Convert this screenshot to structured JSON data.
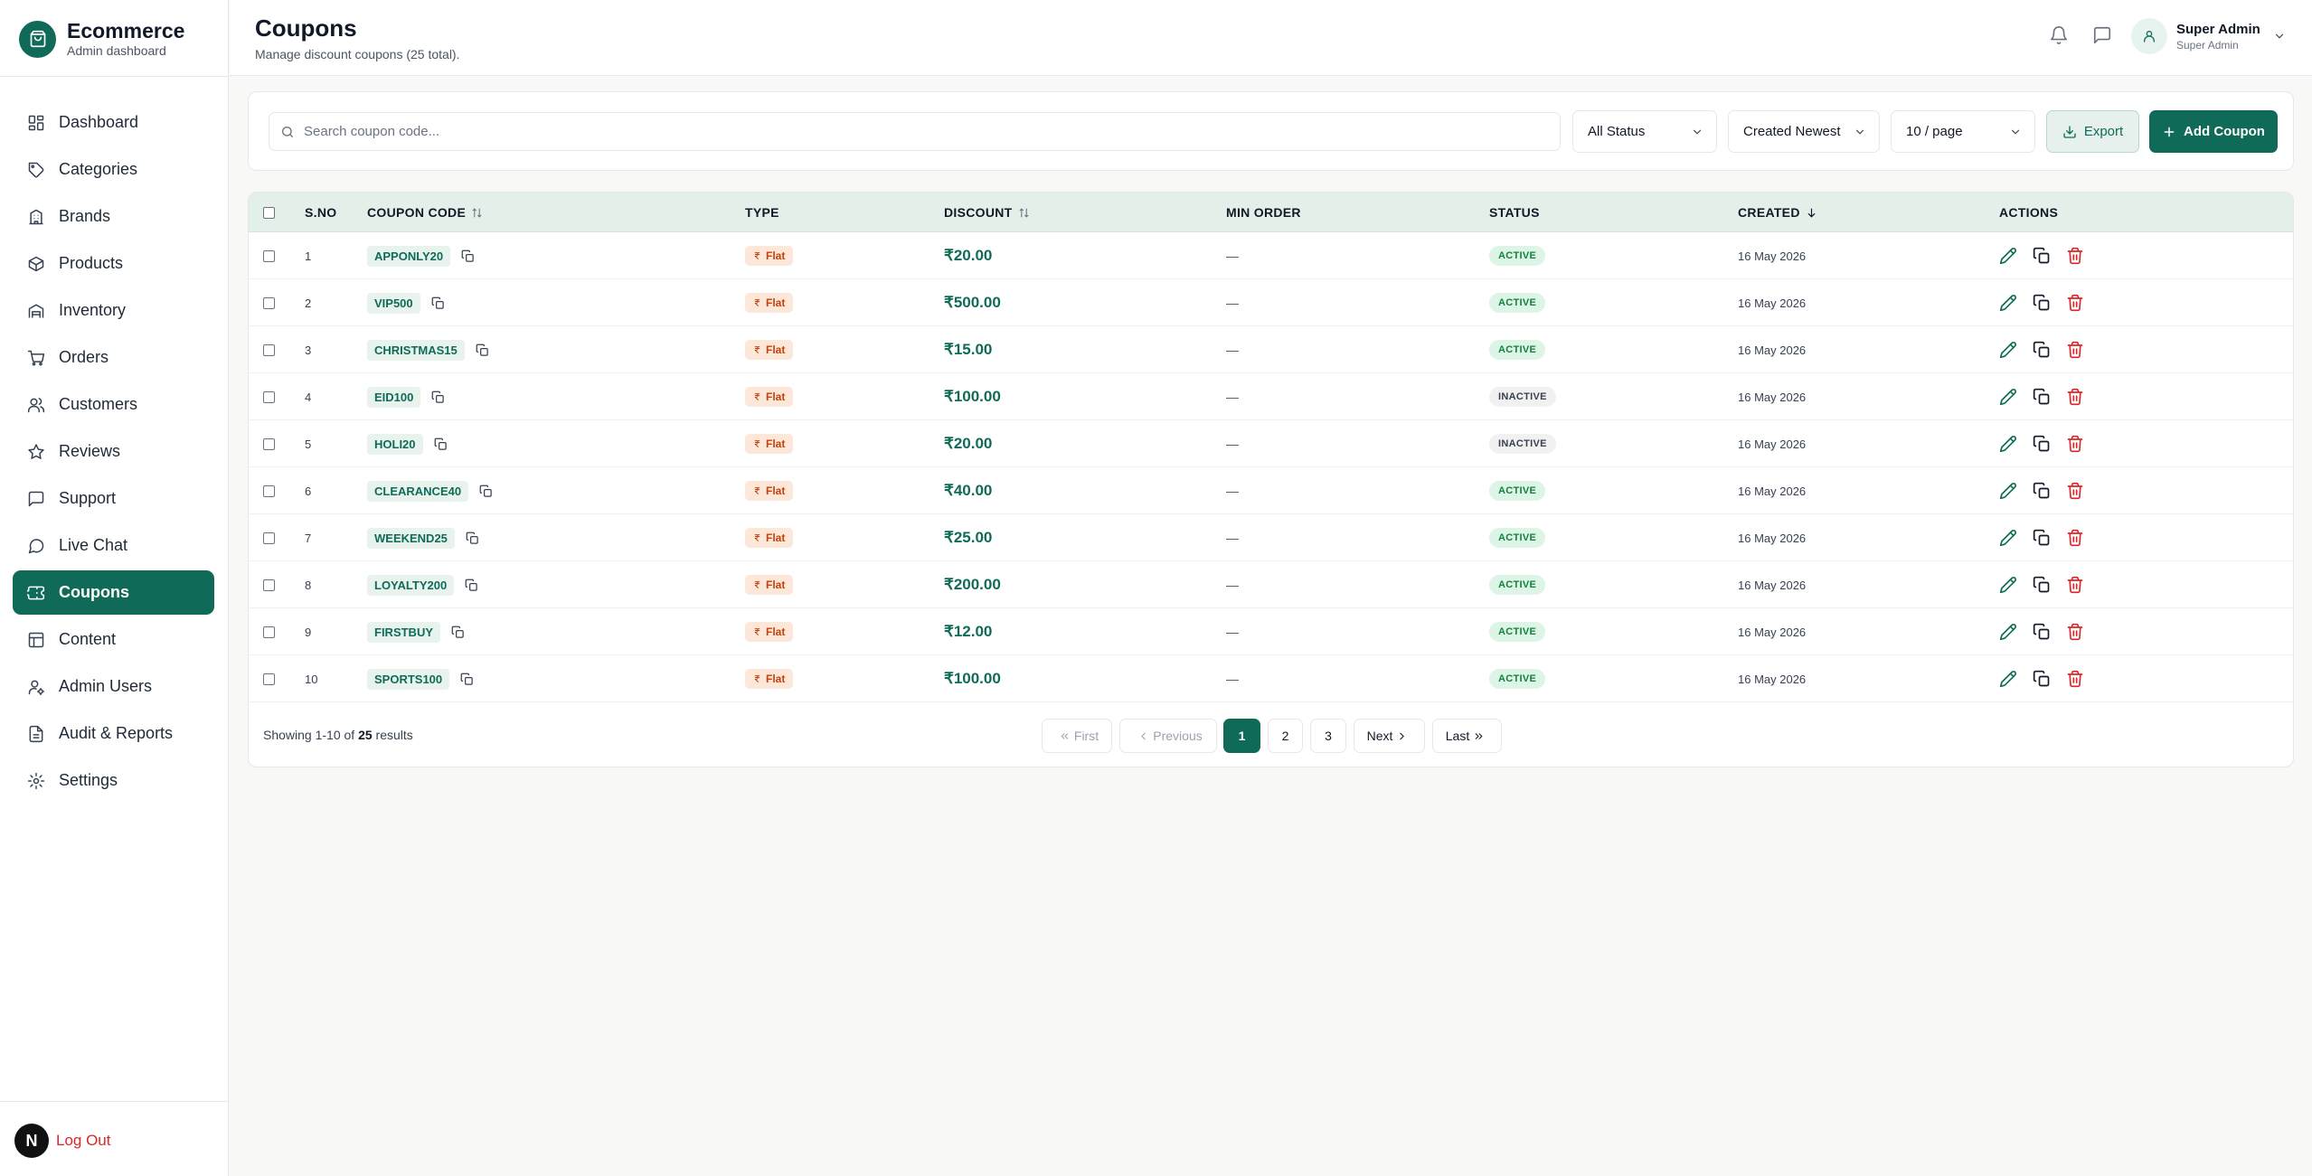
{
  "brand": {
    "title": "Ecommerce",
    "subtitle": "Admin dashboard"
  },
  "sidebar": {
    "items": [
      {
        "label": "Dashboard",
        "icon": "dashboard-grid-icon"
      },
      {
        "label": "Categories",
        "icon": "tag-icon"
      },
      {
        "label": "Brands",
        "icon": "building-icon"
      },
      {
        "label": "Products",
        "icon": "box-icon"
      },
      {
        "label": "Inventory",
        "icon": "warehouse-icon"
      },
      {
        "label": "Orders",
        "icon": "cart-icon"
      },
      {
        "label": "Customers",
        "icon": "users-icon"
      },
      {
        "label": "Reviews",
        "icon": "star-icon"
      },
      {
        "label": "Support",
        "icon": "message-square-icon"
      },
      {
        "label": "Live Chat",
        "icon": "message-circle-icon"
      },
      {
        "label": "Coupons",
        "icon": "ticket-icon",
        "active": true
      },
      {
        "label": "Content",
        "icon": "layout-icon"
      },
      {
        "label": "Admin Users",
        "icon": "user-cog-icon"
      },
      {
        "label": "Audit & Reports",
        "icon": "file-report-icon"
      },
      {
        "label": "Settings",
        "icon": "gear-icon"
      }
    ],
    "logout": {
      "avatar": "N",
      "label": "Log Out"
    }
  },
  "header": {
    "title": "Coupons",
    "subtitle": "Manage discount coupons (25 total).",
    "user": {
      "name": "Super Admin",
      "role": "Super Admin"
    }
  },
  "filters": {
    "search_placeholder": "Search coupon code...",
    "status": "All Status",
    "sort": "Created Newest",
    "page_size": "10 / page",
    "export_label": "Export",
    "add_label": "Add Coupon"
  },
  "table": {
    "columns": [
      "S.NO",
      "COUPON CODE",
      "TYPE",
      "DISCOUNT",
      "MIN ORDER",
      "STATUS",
      "CREATED",
      "ACTIONS"
    ],
    "rows": [
      {
        "sno": "1",
        "code": "APPONLY20",
        "type": "Flat",
        "discount": "₹20.00",
        "min_order": "—",
        "status": "ACTIVE",
        "created": "16 May 2026"
      },
      {
        "sno": "2",
        "code": "VIP500",
        "type": "Flat",
        "discount": "₹500.00",
        "min_order": "—",
        "status": "ACTIVE",
        "created": "16 May 2026"
      },
      {
        "sno": "3",
        "code": "CHRISTMAS15",
        "type": "Flat",
        "discount": "₹15.00",
        "min_order": "—",
        "status": "ACTIVE",
        "created": "16 May 2026"
      },
      {
        "sno": "4",
        "code": "EID100",
        "type": "Flat",
        "discount": "₹100.00",
        "min_order": "—",
        "status": "INACTIVE",
        "created": "16 May 2026"
      },
      {
        "sno": "5",
        "code": "HOLI20",
        "type": "Flat",
        "discount": "₹20.00",
        "min_order": "—",
        "status": "INACTIVE",
        "created": "16 May 2026"
      },
      {
        "sno": "6",
        "code": "CLEARANCE40",
        "type": "Flat",
        "discount": "₹40.00",
        "min_order": "—",
        "status": "ACTIVE",
        "created": "16 May 2026"
      },
      {
        "sno": "7",
        "code": "WEEKEND25",
        "type": "Flat",
        "discount": "₹25.00",
        "min_order": "—",
        "status": "ACTIVE",
        "created": "16 May 2026"
      },
      {
        "sno": "8",
        "code": "LOYALTY200",
        "type": "Flat",
        "discount": "₹200.00",
        "min_order": "—",
        "status": "ACTIVE",
        "created": "16 May 2026"
      },
      {
        "sno": "9",
        "code": "FIRSTBUY",
        "type": "Flat",
        "discount": "₹12.00",
        "min_order": "—",
        "status": "ACTIVE",
        "created": "16 May 2026"
      },
      {
        "sno": "10",
        "code": "SPORTS100",
        "type": "Flat",
        "discount": "₹100.00",
        "min_order": "—",
        "status": "ACTIVE",
        "created": "16 May 2026"
      }
    ]
  },
  "pagination": {
    "showing_prefix": "Showing 1-10 of",
    "total": "25",
    "showing_suffix": "results",
    "first": "First",
    "previous": "Previous",
    "pages": [
      "1",
      "2",
      "3"
    ],
    "current": "1",
    "next": "Next",
    "last": "Last"
  },
  "colors": {
    "primary": "#0f6b57",
    "active_bg": "#dcf5e6",
    "danger": "#dc2626",
    "flat_badge": "#fde7d8"
  }
}
